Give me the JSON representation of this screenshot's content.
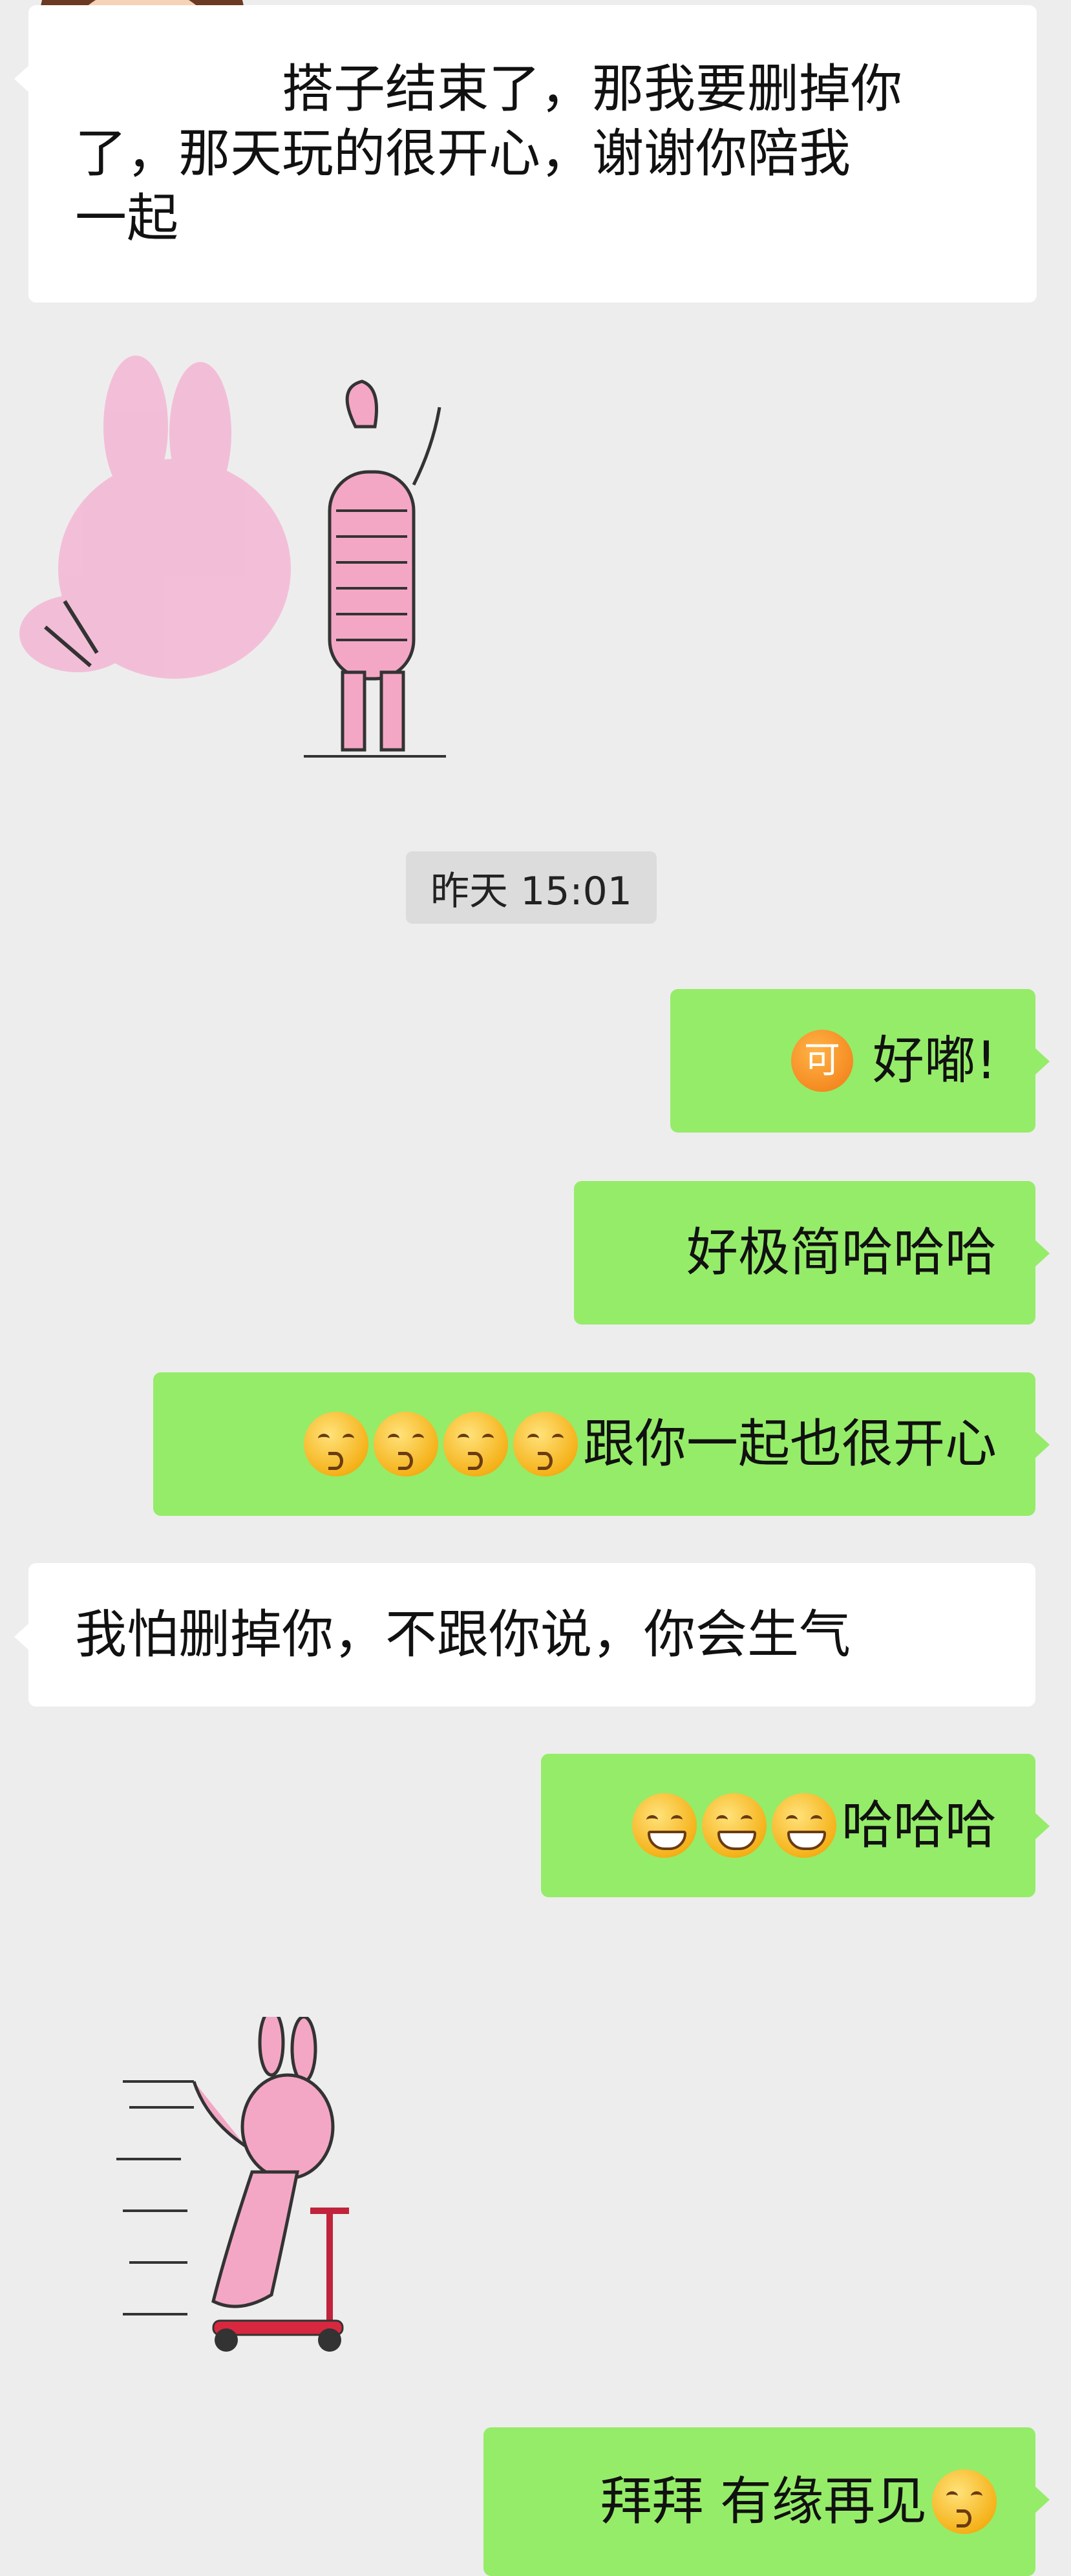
{
  "messages": {
    "m1": {
      "text_line1": "搭子结束了，那我要删掉你",
      "text_line2": "了，那天玩的很开心，谢谢你陪我",
      "text_line3": "一起"
    },
    "time": "昨天 15:01",
    "m2": {
      "badge": "可",
      "text": "好嘟!"
    },
    "m3": {
      "text": "好极简哈哈哈"
    },
    "m4": {
      "text": "跟你一起也很开心"
    },
    "m5": {
      "text": "我怕删掉你，不跟你说，你会生气"
    },
    "m6": {
      "text": "哈哈哈"
    },
    "m7": {
      "text": "拜拜 有缘再见"
    }
  },
  "icons": {
    "avatar": "cartoon-girl-avatar",
    "sticker1": "pink-rabbit-waving-sticker",
    "sticker2": "pink-rabbit-scooter-sticker",
    "emoji_kiss": "kissing-emoji",
    "emoji_grin": "grinning-emoji"
  },
  "colors": {
    "background": "#ededed",
    "outgoing": "#95ec69",
    "incoming": "#ffffff"
  }
}
